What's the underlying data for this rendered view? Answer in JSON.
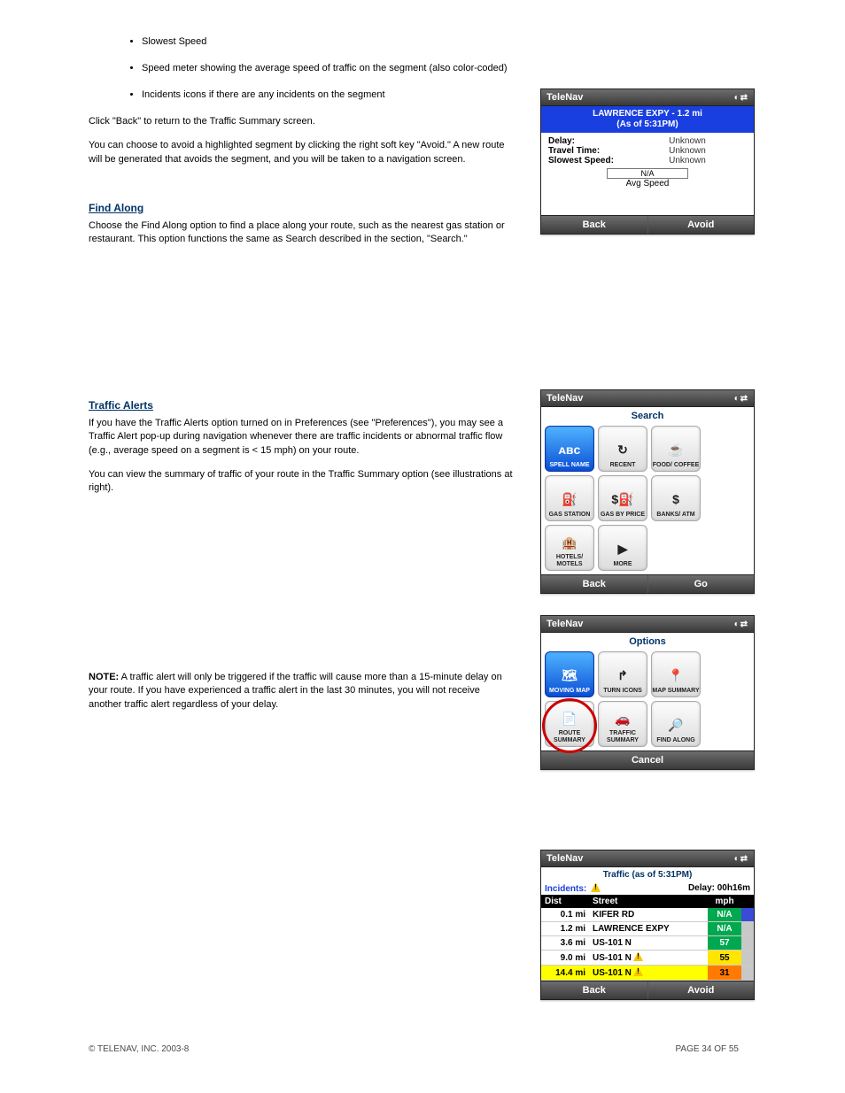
{
  "bullets": [
    "Slowest Speed",
    "Speed meter showing the average speed of traffic on the segment (also color-coded)",
    "Incidents icons if there are any incidents on the segment"
  ],
  "para1": "Click \"Back\" to return to the Traffic Summary screen.",
  "para2": "You can choose to avoid a highlighted segment by clicking the right soft key \"Avoid.\" A new route will be generated that avoids the segment, and you will be taken to a navigation screen.",
  "sect1": {
    "heading": "Find Along",
    "body": "Choose the Find Along option to find a place along your route, such as the nearest gas station or restaurant. This option functions the same as Search described in the section, \"Search.\""
  },
  "sect2": {
    "heading": "Traffic Alerts",
    "p1": "If you have the Traffic Alerts option turned on in Preferences (see \"Preferences\"), you may see a Traffic Alert pop-up during navigation whenever there are traffic incidents or abnormal traffic flow (e.g., average speed on a segment is < 15 mph) on your route.",
    "p2": "You can view the summary of traffic of your route in the Traffic Summary option (see illustrations at right).",
    "note_label": "NOTE:",
    "note_text": " A traffic alert will only be triggered if the traffic will cause more than a 15-minute delay on your route. If you have experienced a traffic alert in the last 30 minutes, you will not receive another traffic alert regardless of your delay."
  },
  "phone1": {
    "title": "TeleNav",
    "hdr_line1": "LAWRENCE EXPY - 1.2 mi",
    "hdr_line2": "(As of 5:31PM)",
    "rows": [
      {
        "label": "Delay:",
        "value": "Unknown"
      },
      {
        "label": "Travel Time:",
        "value": "Unknown"
      },
      {
        "label": "Slowest Speed:",
        "value": "Unknown"
      }
    ],
    "meter": "N/A",
    "avg": "Avg Speed",
    "left": "Back",
    "right": "Avoid"
  },
  "phone2": {
    "title": "TeleNav",
    "header": "Search",
    "tiles": [
      {
        "label": "SPELL NAME",
        "glyph": "ᴀʙᴄ",
        "sel": true
      },
      {
        "label": "RECENT",
        "glyph": "↻"
      },
      {
        "label": "FOOD/ COFFEE",
        "glyph": "☕"
      },
      {
        "label": "GAS STATION",
        "glyph": "⛽"
      },
      {
        "label": "GAS BY PRICE",
        "glyph": "$⛽"
      },
      {
        "label": "BANKS/ ATM",
        "glyph": "$"
      },
      {
        "label": "HOTELS/ MOTELS",
        "glyph": "🏨"
      },
      {
        "label": "MORE",
        "glyph": "▶"
      }
    ],
    "left": "Back",
    "right": "Go"
  },
  "phone3": {
    "title": "TeleNav",
    "header": "Options",
    "tiles": [
      {
        "label": "MOVING MAP",
        "glyph": "🗺",
        "sel": true
      },
      {
        "label": "TURN ICONS",
        "glyph": "↱"
      },
      {
        "label": "MAP SUMMARY",
        "glyph": "📍"
      },
      {
        "label": "ROUTE SUMMARY",
        "glyph": "📄"
      },
      {
        "label": "TRAFFIC SUMMARY",
        "glyph": "🚗"
      },
      {
        "label": "FIND ALONG",
        "glyph": "🔎"
      }
    ],
    "soft": "Cancel"
  },
  "phone4": {
    "title": "TeleNav",
    "header": "Traffic (as of 5:31PM)",
    "incidents_label": "Incidents:",
    "delay": "Delay: 00h16m",
    "cols": {
      "dist": "Dist",
      "street": "Street",
      "mph": "mph"
    },
    "rows": [
      {
        "dist": "0.1 mi",
        "street": "KIFER RD",
        "warn": false,
        "mph": "N/A",
        "mph_bg": "#00a84f",
        "row_bg": "#ffffff"
      },
      {
        "dist": "1.2 mi",
        "street": "LAWRENCE EXPY",
        "warn": false,
        "mph": "N/A",
        "mph_bg": "#00a84f",
        "row_bg": "#ffffff"
      },
      {
        "dist": "3.6 mi",
        "street": "US-101 N",
        "warn": false,
        "mph": "57",
        "mph_bg": "#00a84f",
        "row_bg": "#ffffff"
      },
      {
        "dist": "9.0 mi",
        "street": "US-101 N",
        "warn": true,
        "mph": "55",
        "mph_bg": "#ffe600",
        "row_bg": "#ffffff"
      },
      {
        "dist": "14.4 mi",
        "street": "US-101 N",
        "warn": true,
        "mph": "31",
        "mph_bg": "#ff7a00",
        "row_bg": "#ffff00"
      }
    ],
    "left": "Back",
    "right": "Avoid"
  },
  "page_no": "34"
}
